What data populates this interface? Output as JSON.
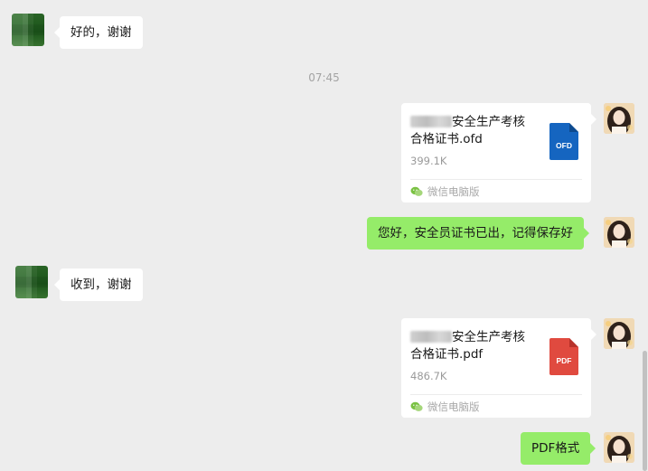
{
  "messages": {
    "m1": {
      "text": "好的，谢谢"
    },
    "time": "07:45",
    "file1": {
      "name_line1": "安全生产考核",
      "name_line2": "合格证书.ofd",
      "size": "399.1K",
      "icon_label": "OFD",
      "icon_color": "#1565c0",
      "source": "微信电脑版"
    },
    "m2": {
      "text": "您好，安全员证书已出，记得保存好"
    },
    "m3": {
      "text": "收到，谢谢"
    },
    "file2": {
      "name_line1": "安全生产考核",
      "name_line2": "合格证书.pdf",
      "size": "486.7K",
      "icon_label": "PDF",
      "icon_color": "#e04a3f",
      "source": "微信电脑版"
    },
    "m4": {
      "text": "PDF格式"
    }
  },
  "colors": {
    "background": "#ededed",
    "sent_bubble": "#95ec69",
    "received_bubble": "#ffffff"
  }
}
